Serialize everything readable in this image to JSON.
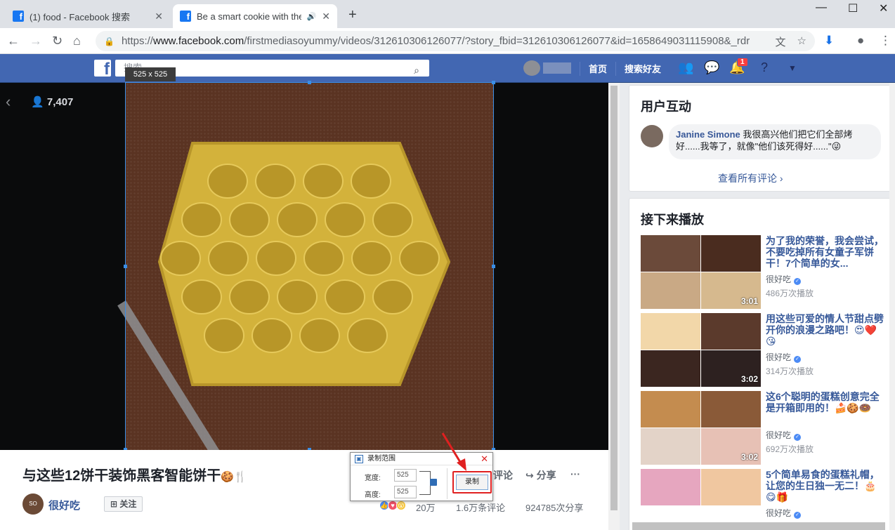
{
  "browser": {
    "tabs": [
      {
        "title": "(1) food - Facebook 搜索",
        "active": false
      },
      {
        "title": "Be a smart cookie with the",
        "active": true
      }
    ],
    "url": {
      "scheme": "https://",
      "host": "www.facebook.com",
      "path": "/firstmediasoyummy/videos/312610306126077/?story_fbid=312610306126077&id=1658649031115908&_rdr"
    }
  },
  "fb_header": {
    "search_placeholder": "搜索",
    "home": "首页",
    "find_friends": "搜索好友",
    "notification_count": "1"
  },
  "video": {
    "viewers": "7,407",
    "selection_size": "525 x 525",
    "title": "与这些12饼干装饰黑客智能饼干",
    "title_emoji": "🍪🍴",
    "page_name": "很好吃",
    "page_avatar_text": "SO yummy",
    "follow": "关注",
    "comment_action": "评论",
    "share_action": "分享",
    "more": "···",
    "reactions_count": "20万",
    "comments_count": "1.6万条评论",
    "shares_count": "924785次分享"
  },
  "record_dialog": {
    "title": "录制范围",
    "width_label": "宽度:",
    "width_value": "525",
    "height_label": "高度:",
    "height_value": "525",
    "record_button": "录制"
  },
  "comments_panel": {
    "heading": "用户互动",
    "comment_author": "Janine Simone",
    "comment_text": "我很高兴他们把它们全部烤好......我等了，就像\"他们该死得好......\"😜",
    "see_all": "查看所有评论"
  },
  "up_next": {
    "heading": "接下来播放",
    "items": [
      {
        "title": "为了我的荣誉，我会尝试，不要吃掉所有女童子军饼干！7个简单的女...",
        "page": "很好吃",
        "views": "486万次播放",
        "duration": "3:01"
      },
      {
        "title": "用这些可爱的情人节甜点劈开你的浪漫之路吧！😍❤️😘",
        "page": "很好吃",
        "views": "314万次播放",
        "duration": "3:02"
      },
      {
        "title": "这6个聪明的蛋糕创意完全是开箱即用的！🍰🍪🍩",
        "page": "很好吃",
        "views": "692万次播放",
        "duration": "3:02"
      },
      {
        "title": "5个简单易食的蛋糕礼帽，让您的生日独一无二！🎂😋🎁",
        "page": "很好吃",
        "views": "",
        "duration": ""
      }
    ]
  },
  "colors": {
    "fb_blue": "#4267b2",
    "link_blue": "#365899",
    "selection_blue": "#3a8ee6",
    "highlight_red": "#e02020"
  }
}
